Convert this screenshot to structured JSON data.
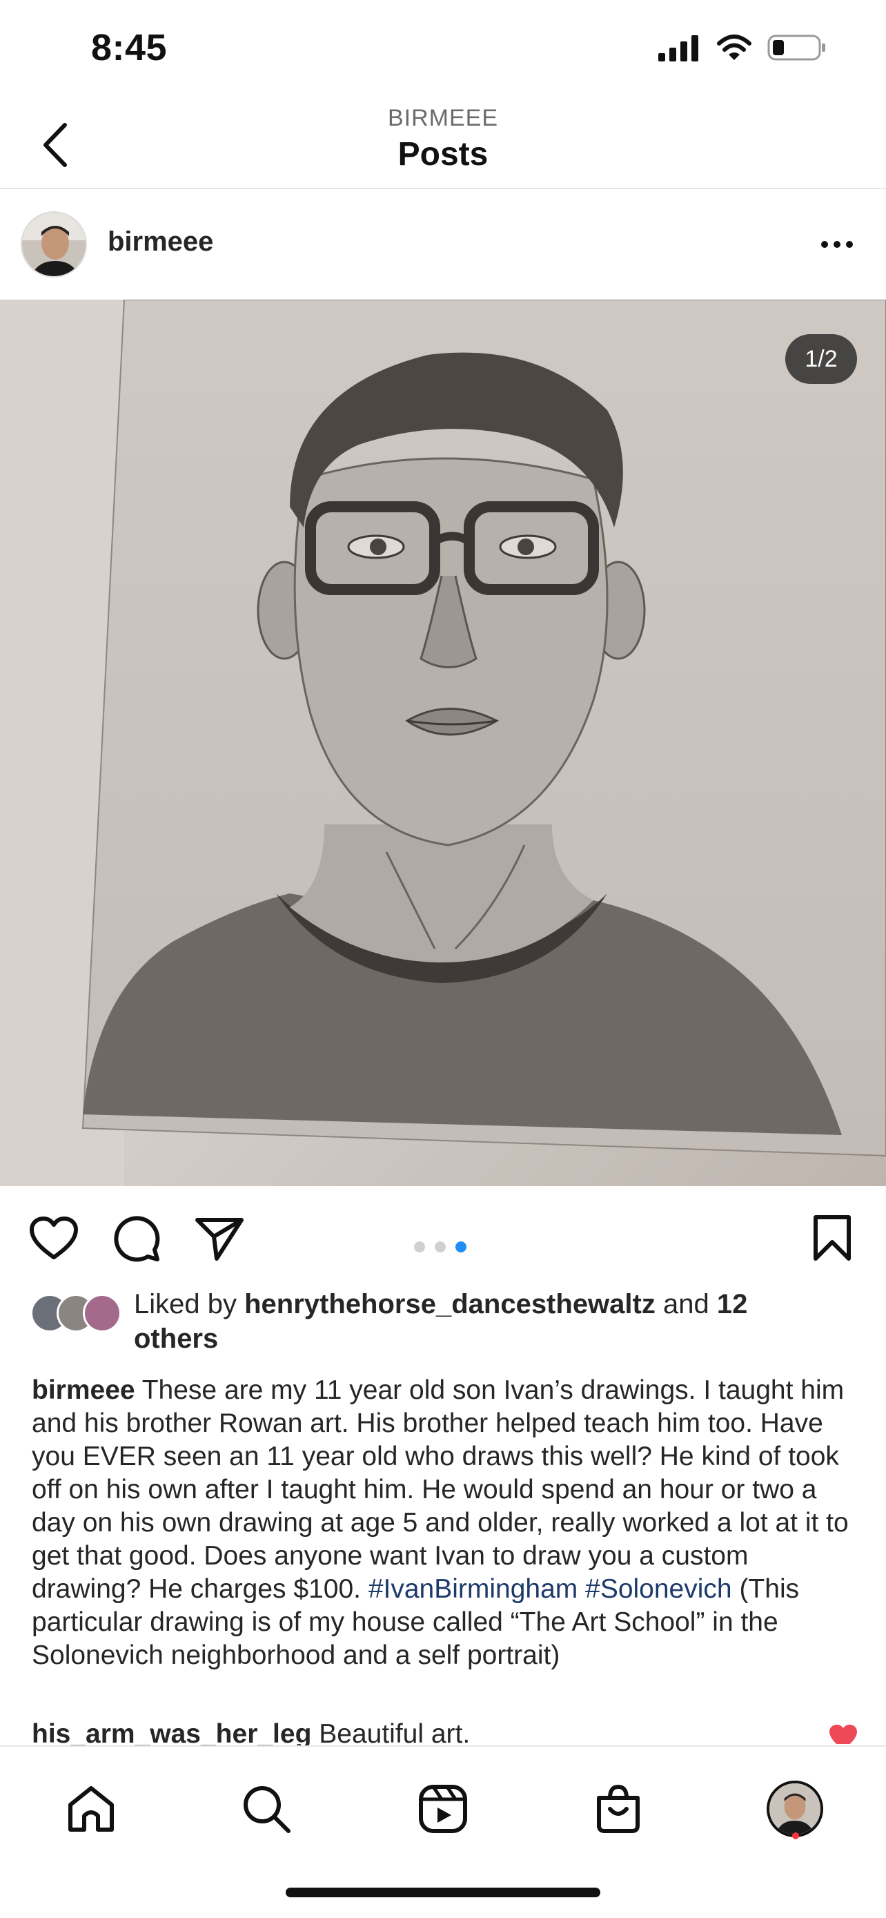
{
  "status_bar": {
    "time": "8:45"
  },
  "header": {
    "subtitle": "BIRMEEE",
    "title": "Posts"
  },
  "post": {
    "username": "birmeee",
    "page_indicator": "1/2",
    "carousel": {
      "total": 3,
      "active_index": 2
    },
    "likes": {
      "prefix": "Liked by ",
      "user": "henrythehorse_dancesthewaltz",
      "middle": " and ",
      "others": "12 others"
    },
    "caption": {
      "username": "birmeee",
      "text_1": " These are my 11 year old son Ivan’s drawings.  I taught him and his brother Rowan art.  His brother helped teach him too.  Have you EVER seen an 11 year old who draws this well?  He kind of took off on his own after I taught him.  He would spend an hour or two a day on his own drawing at age 5 and older, really worked a lot at it to get that good.  Does anyone want Ivan to draw you a custom drawing?  He charges $100. ",
      "hashtag_1": "#IvanBirmingham",
      "space": " ",
      "hashtag_2": "#Solonevich",
      "text_2": " (This particular drawing is of my house called “The Art School” in the Solonevich neighborhood and a self portrait)"
    },
    "comment": {
      "username": "his_arm_was_her_leg",
      "text": " Beautiful art."
    }
  },
  "colors": {
    "accent": "#1f8ff5",
    "hashtag": "#1d3a6b",
    "like_red": "#ff3040",
    "notification": "#ff3040"
  },
  "icons": {
    "back": "chevron-left-icon",
    "more": "more-icon",
    "like": "heart-icon",
    "comment": "comment-icon",
    "share": "send-icon",
    "save": "bookmark-icon",
    "home": "home-icon",
    "search": "search-icon",
    "reels": "reels-icon",
    "shop": "shopping-bag-icon"
  }
}
